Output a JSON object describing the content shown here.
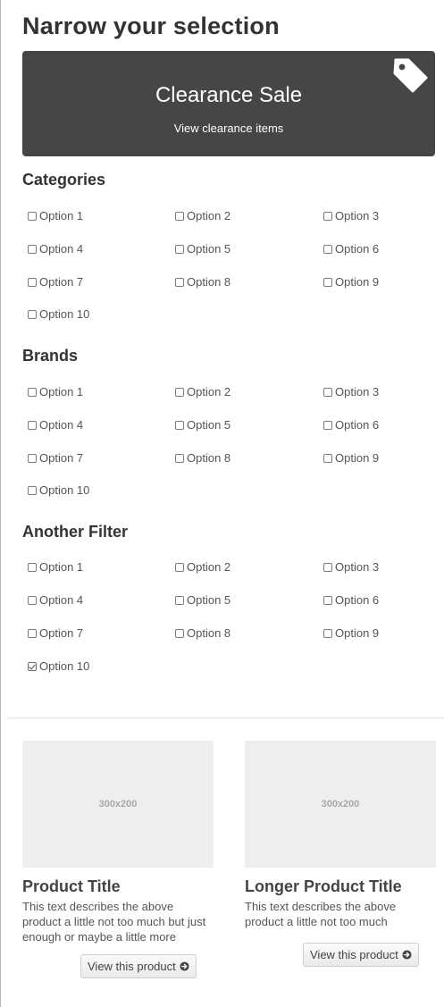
{
  "heading": "Narrow your selection",
  "banner": {
    "title": "Clearance Sale",
    "subtitle": "View clearance items",
    "icon": "tag-icon"
  },
  "filters": [
    {
      "title": "Categories",
      "options": [
        {
          "label": "Option 1",
          "checked": false
        },
        {
          "label": "Option 2",
          "checked": false
        },
        {
          "label": "Option 3",
          "checked": false
        },
        {
          "label": "Option 4",
          "checked": false
        },
        {
          "label": "Option 5",
          "checked": false
        },
        {
          "label": "Option 6",
          "checked": false
        },
        {
          "label": "Option 7",
          "checked": false
        },
        {
          "label": "Option 8",
          "checked": false
        },
        {
          "label": "Option 9",
          "checked": false
        },
        {
          "label": "Option 10",
          "checked": false
        }
      ]
    },
    {
      "title": "Brands",
      "options": [
        {
          "label": "Option 1",
          "checked": false
        },
        {
          "label": "Option 2",
          "checked": false
        },
        {
          "label": "Option 3",
          "checked": false
        },
        {
          "label": "Option 4",
          "checked": false
        },
        {
          "label": "Option 5",
          "checked": false
        },
        {
          "label": "Option 6",
          "checked": false
        },
        {
          "label": "Option 7",
          "checked": false
        },
        {
          "label": "Option 8",
          "checked": false
        },
        {
          "label": "Option 9",
          "checked": false
        },
        {
          "label": "Option 10",
          "checked": false
        }
      ]
    },
    {
      "title": "Another Filter",
      "options": [
        {
          "label": "Option 1",
          "checked": false
        },
        {
          "label": "Option 2",
          "checked": false
        },
        {
          "label": "Option 3",
          "checked": false
        },
        {
          "label": "Option 4",
          "checked": false
        },
        {
          "label": "Option 5",
          "checked": false
        },
        {
          "label": "Option 6",
          "checked": false
        },
        {
          "label": "Option 7",
          "checked": false
        },
        {
          "label": "Option 8",
          "checked": false
        },
        {
          "label": "Option 9",
          "checked": false
        },
        {
          "label": "Option 10",
          "checked": true
        }
      ]
    }
  ],
  "products": [
    {
      "image_placeholder": "300x200",
      "title": "Product Title",
      "description": "This text describes the above product a little not too much but just enough or maybe a little more",
      "button_label": "View this product",
      "button_icon": "arrow-circle-right-icon"
    },
    {
      "image_placeholder": "300x200",
      "title": "Longer Product Title",
      "description": "This text describes the above product a little not too much",
      "button_label": "View this product",
      "button_icon": "arrow-circle-right-icon"
    }
  ],
  "colors": {
    "banner_bg": "#464646",
    "placeholder_bg": "#eeeeee",
    "text": "#333333"
  }
}
